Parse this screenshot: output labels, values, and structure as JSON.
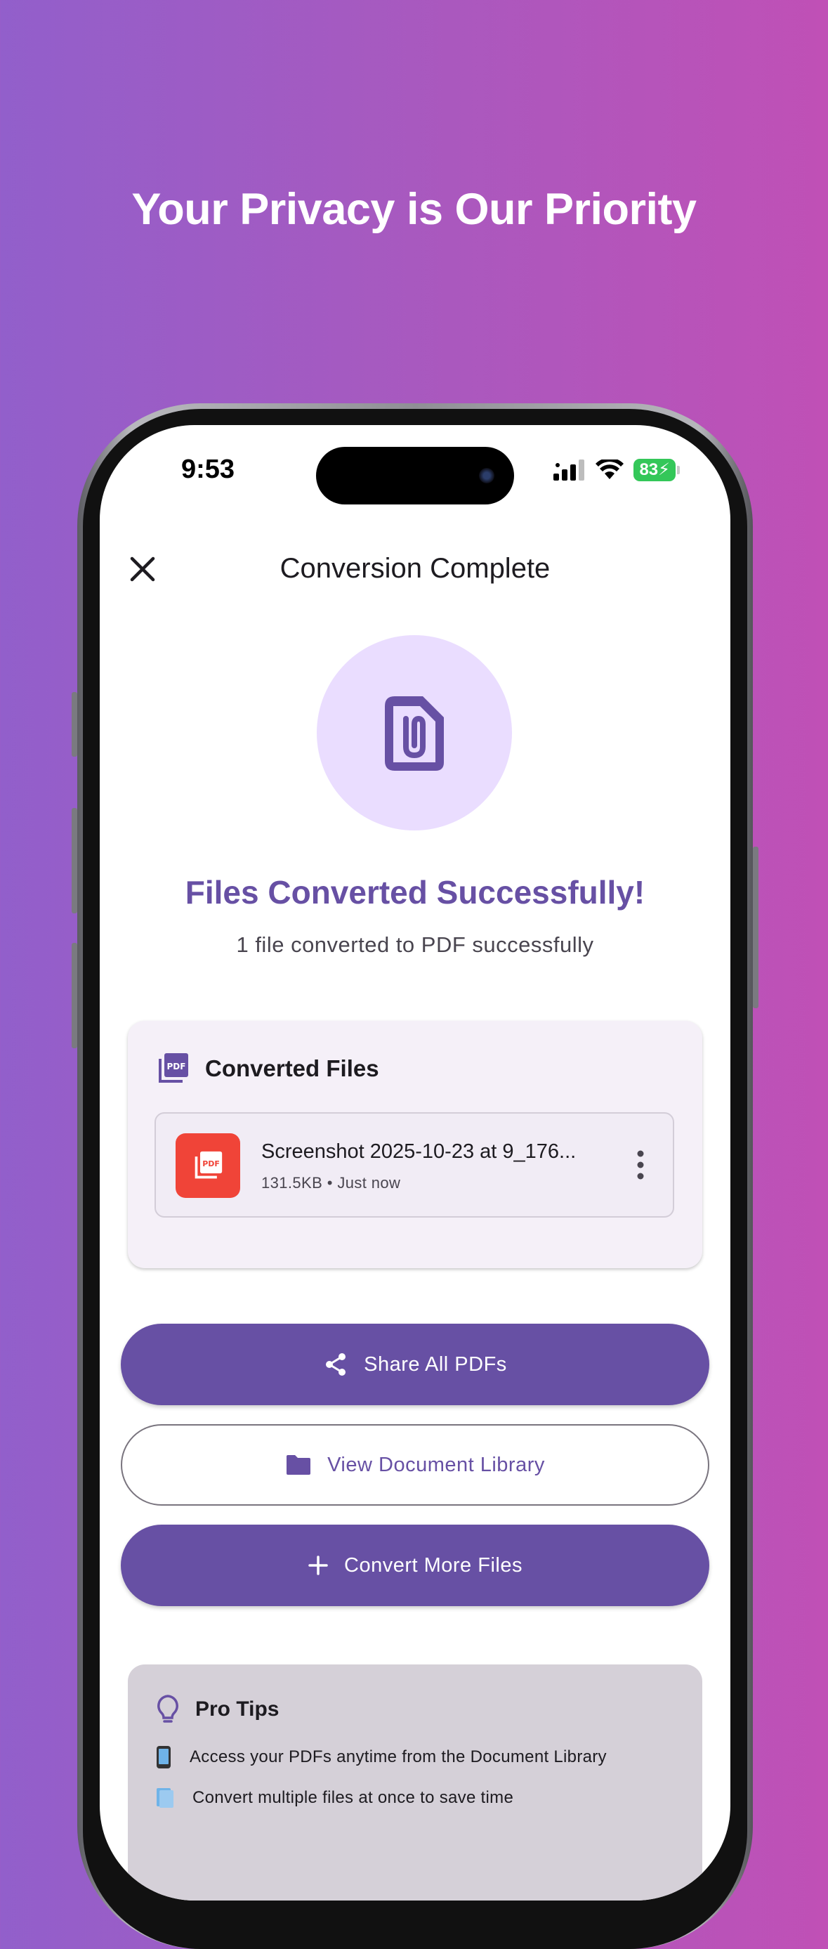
{
  "marketing": {
    "headline": "Your Privacy is Our Priority"
  },
  "status_bar": {
    "time": "9:53",
    "battery": "83"
  },
  "app_bar": {
    "title": "Conversion Complete",
    "close_icon": "close-icon"
  },
  "hero": {
    "icon": "file-attachment-icon",
    "title": "Files Converted Successfully!",
    "subtitle": "1 file converted to PDF successfully"
  },
  "converted_files": {
    "title": "Converted Files",
    "header_icon": "pdf-stack-icon",
    "files": [
      {
        "name": "Screenshot 2025-10-23 at 9_176...",
        "meta": "131.5KB • Just now",
        "icon": "pdf-icon"
      }
    ]
  },
  "actions": {
    "share_label": "Share All PDFs",
    "library_label": "View Document Library",
    "convert_label": "Convert More Files"
  },
  "tips": {
    "title": "Pro Tips",
    "items": [
      {
        "icon": "phone-emoji",
        "text": "Access your PDFs anytime from the Document Library"
      },
      {
        "icon": "files-emoji",
        "text": "Convert multiple files at once to save time"
      }
    ]
  },
  "colors": {
    "primary": "#6750A4",
    "hero_bg": "#EADDFF",
    "pdf_red": "#F04438",
    "battery_green": "#34C759"
  }
}
